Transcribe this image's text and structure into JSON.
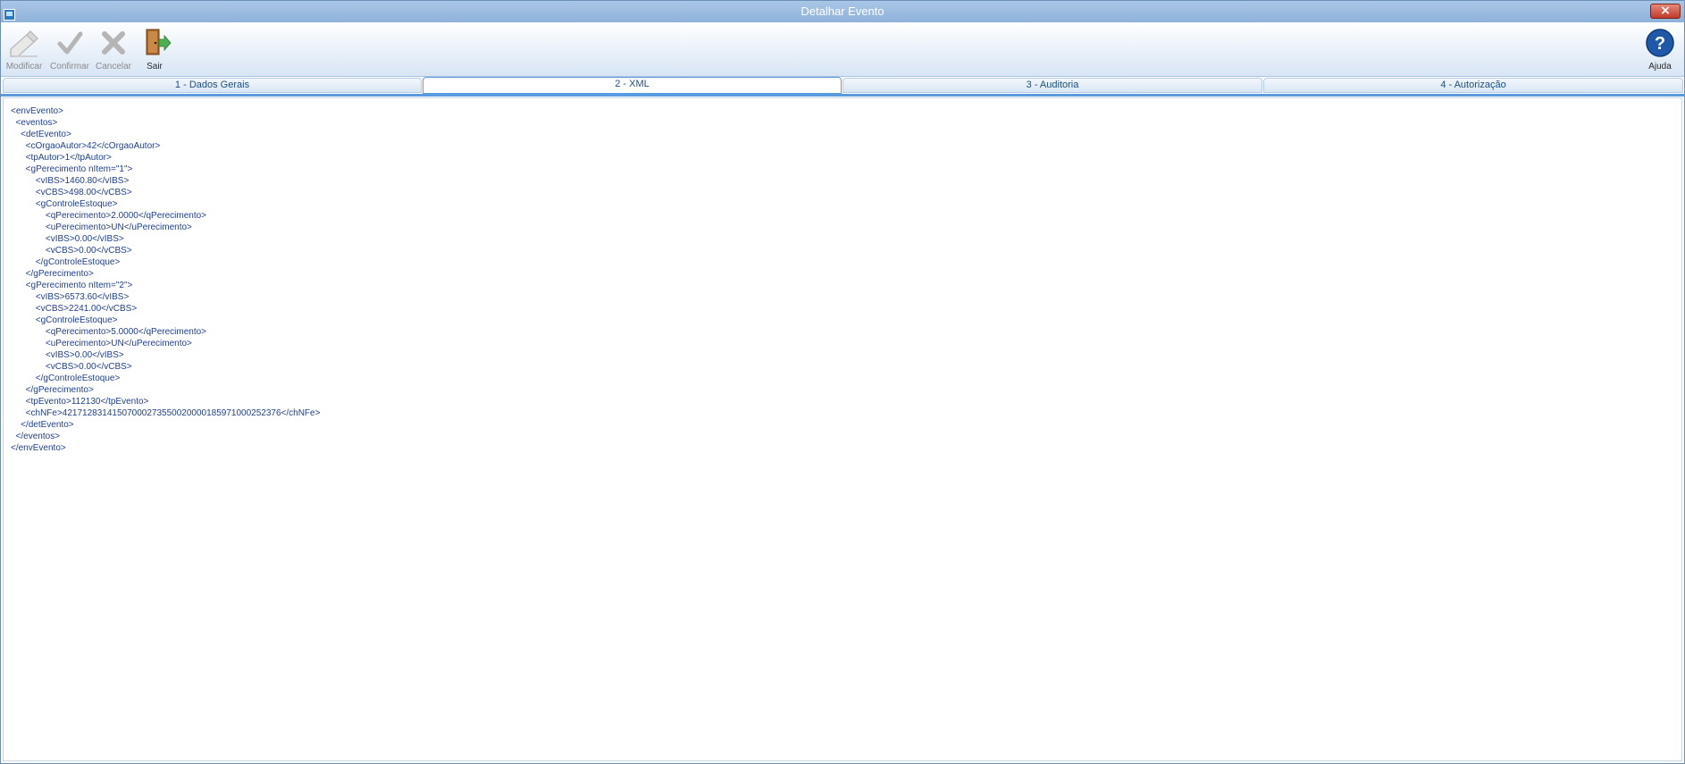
{
  "window": {
    "title": "Detalhar Evento",
    "close_symbol": "×"
  },
  "toolbar": {
    "buttons": [
      {
        "label": "Modificar",
        "icon": "edit-icon",
        "enabled": false
      },
      {
        "label": "Confirmar",
        "icon": "checkmark-icon",
        "enabled": false
      },
      {
        "label": "Cancelar",
        "icon": "cancel-x-icon",
        "enabled": false
      },
      {
        "label": "Sair",
        "icon": "exit-door-icon",
        "enabled": true
      }
    ],
    "help": {
      "label": "Ajuda",
      "icon": "help-question-icon",
      "symbol": "?"
    }
  },
  "tabs": [
    {
      "label": "1 - Dados Gerais"
    },
    {
      "label": "2 - XML",
      "selected": true
    },
    {
      "label": "3 - Auditoria"
    },
    {
      "label": "4 - Autorização"
    }
  ],
  "colors": {
    "accent": "#5a9be0",
    "xml_text": "#1f3f8f",
    "titlebar": "#9bbce0",
    "close": "#c0392b"
  },
  "xml_lines": [
    "<envEvento>",
    "  <eventos>",
    "    <detEvento>",
    "      <cOrgaoAutor>42</cOrgaoAutor>",
    "      <tpAutor>1</tpAutor>",
    "      <gPerecimento nItem=\"1\">",
    "          <vIBS>1460.80</vIBS>",
    "          <vCBS>498.00</vCBS>",
    "          <gControleEstoque>",
    "              <qPerecimento>2.0000</qPerecimento>",
    "              <uPerecimento>UN</uPerecimento>",
    "              <vIBS>0.00</vIBS>",
    "              <vCBS>0.00</vCBS>",
    "          </gControleEstoque>",
    "      </gPerecimento>",
    "      <gPerecimento nItem=\"2\">",
    "          <vIBS>6573.60</vIBS>",
    "          <vCBS>2241.00</vCBS>",
    "          <gControleEstoque>",
    "              <qPerecimento>5.0000</qPerecimento>",
    "              <uPerecimento>UN</uPerecimento>",
    "              <vIBS>0.00</vIBS>",
    "              <vCBS>0.00</vCBS>",
    "          </gControleEstoque>",
    "      </gPerecimento>",
    "      <tpEvento>112130</tpEvento>",
    "      <chNFe>42171283141507000273550020000185971000252376</chNFe>",
    "    </detEvento>",
    "  </eventos>",
    "</envEvento>"
  ]
}
